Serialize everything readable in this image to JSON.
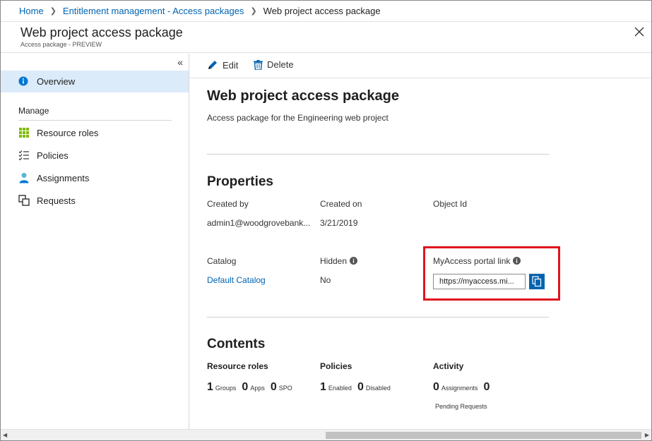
{
  "breadcrumb": {
    "home": "Home",
    "entitlement": "Entitlement management - Access packages",
    "current": "Web project access package"
  },
  "header": {
    "title": "Web project access package",
    "subtitle": "Access package - PREVIEW"
  },
  "sidebar": {
    "collapse_glyph": "«",
    "overview": "Overview",
    "section": "Manage",
    "items": [
      {
        "label": "Resource roles",
        "icon": "grid-icon"
      },
      {
        "label": "Policies",
        "icon": "checklist-icon"
      },
      {
        "label": "Assignments",
        "icon": "user-icon"
      },
      {
        "label": "Requests",
        "icon": "requests-icon"
      }
    ]
  },
  "toolbar": {
    "edit": "Edit",
    "delete": "Delete"
  },
  "main": {
    "title": "Web project access package",
    "description": "Access package for the Engineering web project",
    "properties_title": "Properties",
    "created_by_label": "Created by",
    "created_by_value": "admin1@woodgrovebank...",
    "created_on_label": "Created on",
    "created_on_value": "3/21/2019",
    "object_id_label": "Object Id",
    "catalog_label": "Catalog",
    "catalog_value": "Default Catalog",
    "hidden_label": "Hidden",
    "hidden_value": "No",
    "portal_label": "MyAccess portal link",
    "portal_value": "https://myaccess.mi...",
    "contents_title": "Contents",
    "resource_roles_head": "Resource roles",
    "policies_head": "Policies",
    "activity_head": "Activity",
    "groups_count": "1",
    "groups_label": "Groups",
    "apps_count": "0",
    "apps_label": "Apps",
    "spo_count": "0",
    "spo_label": "SPO",
    "enabled_count": "1",
    "enabled_label": "Enabled",
    "disabled_count": "0",
    "disabled_label": "Disabled",
    "assignments_count": "0",
    "assignments_label": "Assignments",
    "pending_count": "0",
    "pending_label": "Pending Requests"
  },
  "colors": {
    "accent": "#0063b1",
    "selected_bg": "#dcebfa",
    "highlight": "#e0141e"
  }
}
